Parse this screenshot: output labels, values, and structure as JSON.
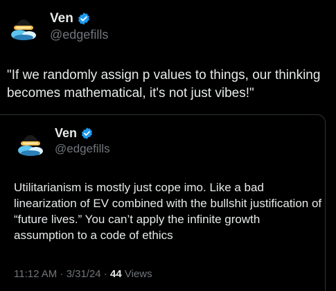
{
  "tweet": {
    "author": {
      "name": "Ven",
      "handle": "@edgefills",
      "verified": true,
      "verified_color": "#1d9bf0"
    },
    "text": "\"If we randomly assign p values to things, our thinking becomes mathematical, it's not just vibes!\""
  },
  "quoted_tweet": {
    "author": {
      "name": "Ven",
      "handle": "@edgefills",
      "verified": true
    },
    "text": "Utilitarianism is mostly just cope imo. Like a bad linearization of EV combined with the bullshit justification of “future lives.” You can’t apply the infinite growth assumption to a code of ethics",
    "timestamp": "11:12 AM · 3/31/24 · ",
    "views_count": "44",
    "views_label": " Views"
  },
  "icons": {
    "verified": "verified-badge-icon",
    "avatar": "avatar-image"
  },
  "colors": {
    "background": "#000000",
    "text": "#e7e9ea",
    "secondary": "#71767b",
    "border": "#2f3336",
    "accent": "#1d9bf0"
  }
}
